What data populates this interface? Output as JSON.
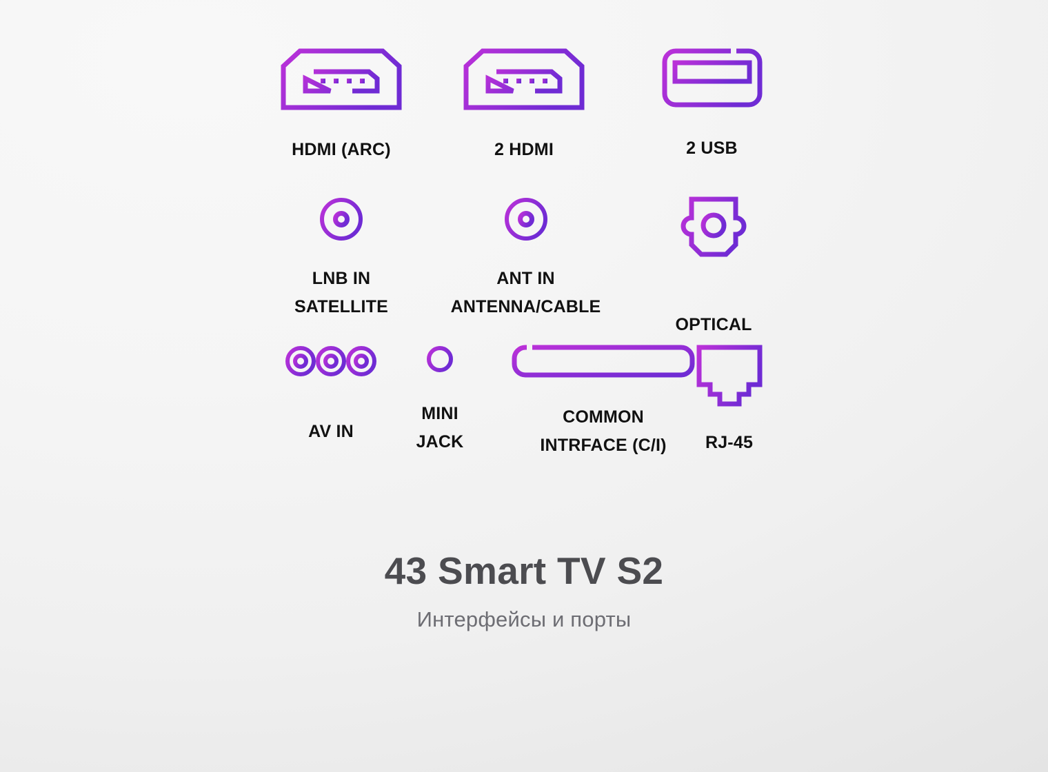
{
  "theme": {
    "background_light": "#f8f8f8",
    "background_dark": "#e0e0e0",
    "icon_gradient_start": "#bb31d8",
    "icon_gradient_end": "#6f2bd4",
    "label_color": "#111111",
    "title_color": "#4c4c50",
    "subtitle_color": "#6d6d73"
  },
  "footer": {
    "title": "43 Smart TV S2",
    "subtitle": "Интерфейсы и порты"
  },
  "ports": {
    "rows": [
      {
        "row_index": 1,
        "cells": [
          {
            "icon": "hdmi-port-icon",
            "label": "HDMI (ARC)"
          },
          {
            "icon": "hdmi-port-icon",
            "label": "2 HDMI"
          },
          {
            "icon": "usb-port-icon",
            "label": "2 USB"
          }
        ]
      },
      {
        "row_index": 2,
        "cells": [
          {
            "icon": "coaxial-port-icon",
            "label": "LNB IN\nSATELLITE"
          },
          {
            "icon": "coaxial-port-icon",
            "label": "ANT IN\nANTENNA/CABLE"
          },
          {
            "icon": "optical-toslink-port-icon",
            "label": "OPTICAL"
          }
        ]
      },
      {
        "row_index": 3,
        "cells": [
          {
            "icon": "rca-av-port-icon",
            "label": "AV IN"
          },
          {
            "icon": "mini-jack-port-icon",
            "label": "MINI\nJACK"
          },
          {
            "icon": "common-interface-slot-icon",
            "label": "COMMON\nINTRFACE (C/I)"
          },
          {
            "icon": "rj45-ethernet-port-icon",
            "label": "RJ-45"
          }
        ]
      }
    ]
  }
}
